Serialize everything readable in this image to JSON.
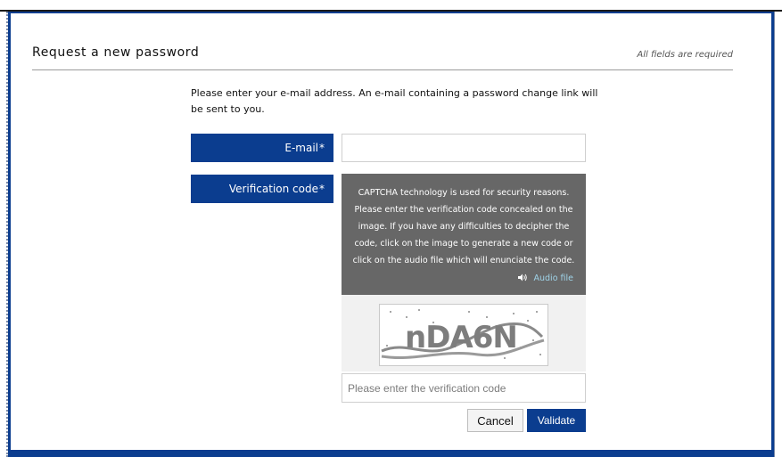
{
  "header": {
    "title": "Request a new password",
    "required_note": "All fields are required"
  },
  "intro": {
    "text": "Please enter your e-mail address. An e-mail containing a password change link will be sent to you."
  },
  "form": {
    "email": {
      "label": "E-mail",
      "required_marker": "*",
      "value": ""
    },
    "verification": {
      "label": "Verification code",
      "required_marker": "*",
      "info_text": "CAPTCHA technology is used for security reasons. Please enter the verification code concealed on the image. If you have any difficulties to decipher the code, click on the image to generate a new code or click on the audio file which will enunciate the code.",
      "audio_label": "Audio file",
      "audio_icon": "speaker-icon",
      "captcha_text": "nDA6N",
      "input_placeholder": "Please enter the verification code",
      "value": ""
    }
  },
  "buttons": {
    "cancel": "Cancel",
    "validate": "Validate"
  },
  "colors": {
    "brand_blue": "#0b3d8f",
    "info_gray": "#676767",
    "link_cyan": "#9fd3e8"
  }
}
